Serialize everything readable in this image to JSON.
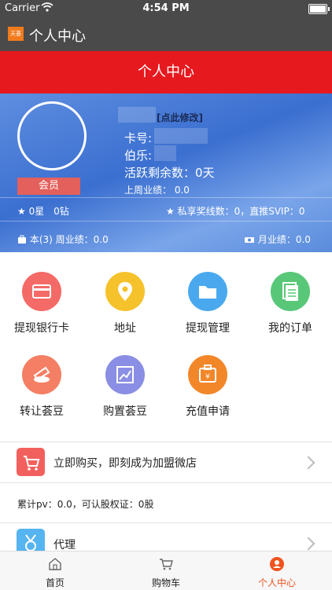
{
  "status_bar": {
    "carrier": "Carrier",
    "time": "4:54 PM"
  },
  "app_bar": {
    "logo_text": "天荟",
    "title": "个人中心"
  },
  "header": {
    "title": "个人中心"
  },
  "profile": {
    "edit_link": "[点此修改]",
    "card_label": "卡号:",
    "bole_label": "伯乐:",
    "active_days": "活跃剩余数：0天",
    "last_week": "上周业绩： 0.0",
    "member_badge": "会员",
    "stars": "0星",
    "diamonds": "0钻",
    "reward_line": "私享奖线数：0，直推SVIP：0",
    "week_perf": "本(3) 周业绩：0.0",
    "month_perf": "月业绩：0.0"
  },
  "grid": [
    {
      "label": "提现银行卡",
      "icon": "bank-card-icon",
      "color": "#f46a66"
    },
    {
      "label": "地址",
      "icon": "location-pin-icon",
      "color": "#f6c22c"
    },
    {
      "label": "提现管理",
      "icon": "folder-icon",
      "color": "#4aa9ee"
    },
    {
      "label": "我的订单",
      "icon": "orders-icon",
      "color": "#58c778"
    },
    {
      "label": "转让荟豆",
      "icon": "transfer-bean-icon",
      "color": "#f47f64"
    },
    {
      "label": "购置荟豆",
      "icon": "chart-trend-icon",
      "color": "#8a8ee4"
    },
    {
      "label": "充值申请",
      "icon": "recharge-bag-icon",
      "color": "#f2872a"
    }
  ],
  "buy_row": {
    "text": "立即购买，即刻成为加盟微店"
  },
  "pv_row": {
    "text": "累计pv：0.0，可认股权证：0股"
  },
  "agent_row": {
    "text": "代理"
  },
  "tabs": [
    {
      "label": "首页"
    },
    {
      "label": "购物车"
    },
    {
      "label": "个人中心",
      "active_color": "#f0541f"
    }
  ]
}
